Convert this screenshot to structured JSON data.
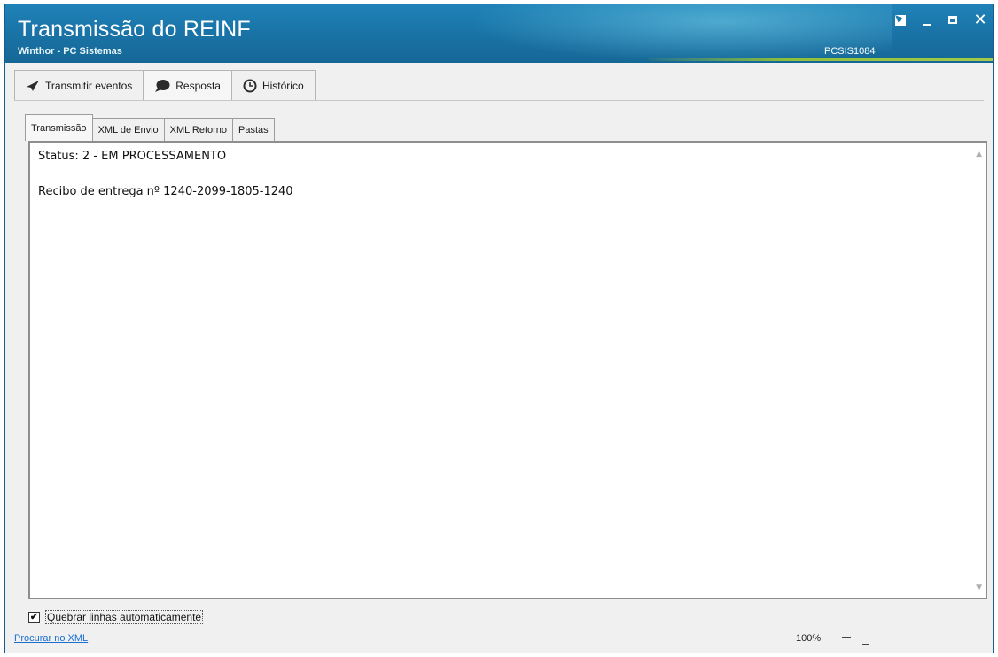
{
  "window": {
    "title": "Transmissão do REINF",
    "subtitle": "Winthor - PC Sistemas",
    "code": "PCSIS1084",
    "close_glyph": "✕"
  },
  "top_tabs": [
    {
      "label": "Transmitir eventos",
      "icon": "send-icon"
    },
    {
      "label": "Resposta",
      "icon": "speech-bubble-icon"
    },
    {
      "label": "Histórico",
      "icon": "clock-icon"
    }
  ],
  "sub_tabs": [
    {
      "label": "Transmissão"
    },
    {
      "label": "XML de Envio"
    },
    {
      "label": "XML Retorno"
    },
    {
      "label": "Pastas"
    }
  ],
  "content": {
    "status_line": "Status: 2 - EM PROCESSAMENTO",
    "receipt_line": "Recibo de entrega nº 1240-2099-1805-1240"
  },
  "footer": {
    "wrap_checkbox_checked": true,
    "wrap_checkbox_glyph": "✔",
    "wrap_label": "Quebrar linhas automaticamente",
    "search_link": "Procurar no XML",
    "zoom_label": "100%"
  },
  "colors": {
    "titlebar": "#1a74a8",
    "accent": "#8fbf3a",
    "link": "#1b6fd0"
  }
}
